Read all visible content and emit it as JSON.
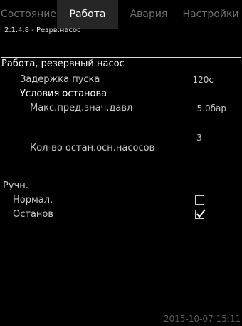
{
  "tabs": [
    {
      "label": "Состояние",
      "active": false
    },
    {
      "label": "Работа",
      "active": true
    },
    {
      "label": "Авария",
      "active": false
    },
    {
      "label": "Настройки",
      "active": false
    }
  ],
  "breadcrumb": "2.1.4.8 - Резрв.насос",
  "section": {
    "title": "Работа, резервный насос",
    "start_delay_label": "Задержка пуска",
    "start_delay_value": "120с",
    "stop_conditions_label": "Условия останова",
    "max_pressure_label": "Макс.пред.знач.давл",
    "max_pressure_value": "5.0бар",
    "stopped_pumps_label": "Кол-во остан.осн.насосов",
    "stopped_pumps_value": "3"
  },
  "manual": {
    "title": "Ручн.",
    "normal_label": "Нормал.",
    "normal_checked": false,
    "stop_label": "Останов",
    "stop_checked": true
  },
  "timestamp": "2015-10-07 15:11",
  "colors": {
    "active_tab_bg": "#262626",
    "inactive_tab_text": "#6f6f6f",
    "background": "#000000"
  }
}
